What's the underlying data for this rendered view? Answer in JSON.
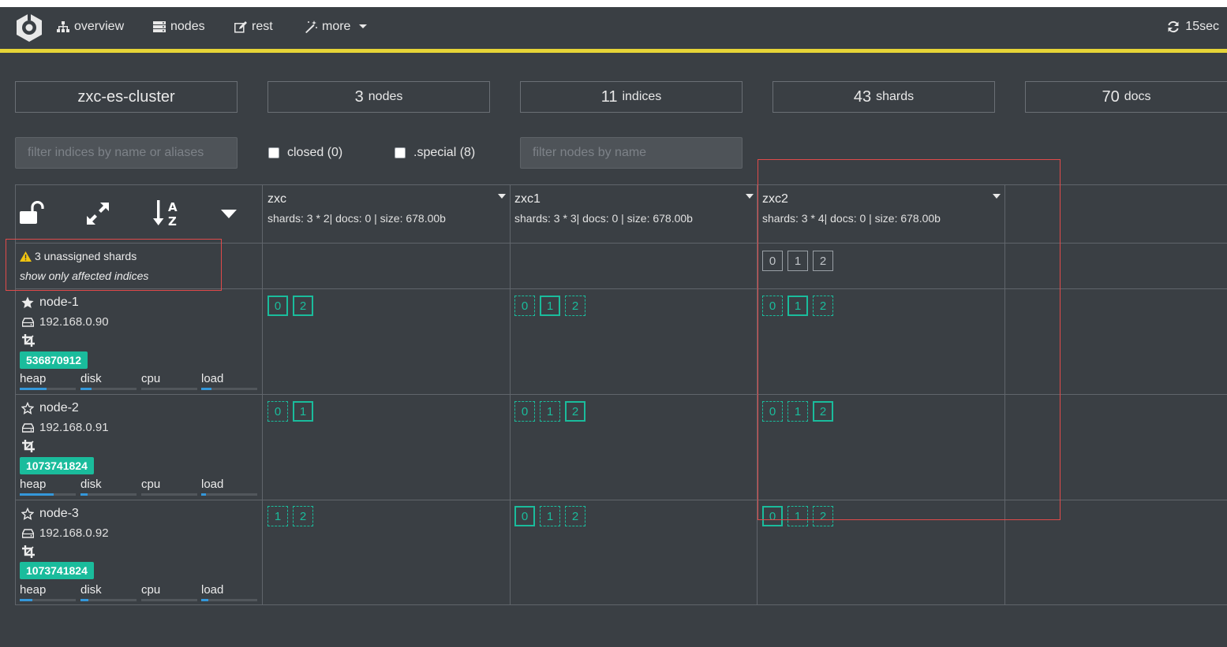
{
  "nav": {
    "overview": "overview",
    "nodes": "nodes",
    "rest": "rest",
    "more": "more",
    "refresh": "15sec"
  },
  "stats": {
    "cluster_name": "zxc-es-cluster",
    "nodes_num": "3",
    "nodes_label": "nodes",
    "indices_num": "11",
    "indices_label": "indices",
    "shards_num": "43",
    "shards_label": "shards",
    "docs_num": "70",
    "docs_label": "docs"
  },
  "filters": {
    "indices_placeholder": "filter indices by name or aliases",
    "closed_label": "closed (0)",
    "special_label": ".special (8)",
    "nodes_placeholder": "filter nodes by name"
  },
  "unassigned": {
    "text": "3 unassigned shards",
    "link": "show only affected indices"
  },
  "indices": [
    {
      "name": "zxc",
      "info": "shards: 3 * 2| docs: 0 | size: 678.00b"
    },
    {
      "name": "zxc1",
      "info": "shards: 3 * 3| docs: 0 | size: 678.00b"
    },
    {
      "name": "zxc2",
      "info": "shards: 3 * 4| docs: 0 | size: 678.00b"
    }
  ],
  "unassigned_shards": {
    "zxc2": [
      "0",
      "1",
      "2"
    ]
  },
  "nodes": [
    {
      "name": "node-1",
      "master": true,
      "ip": "192.168.0.90",
      "heap_badge": "536870912",
      "metrics": {
        "heap": "heap",
        "disk": "disk",
        "cpu": "cpu",
        "load": "load"
      },
      "levels": {
        "heap": 0.48,
        "disk": 0.2,
        "cpu": 0.0,
        "load": 0.18
      },
      "shards": [
        [
          {
            "n": "0",
            "t": "primary"
          },
          {
            "n": "2",
            "t": "primary"
          }
        ],
        [
          {
            "n": "0",
            "t": "replica"
          },
          {
            "n": "1",
            "t": "primary"
          },
          {
            "n": "2",
            "t": "replica"
          }
        ],
        [
          {
            "n": "0",
            "t": "replica"
          },
          {
            "n": "1",
            "t": "primary"
          },
          {
            "n": "2",
            "t": "replica"
          }
        ]
      ]
    },
    {
      "name": "node-2",
      "master": false,
      "ip": "192.168.0.91",
      "heap_badge": "1073741824",
      "metrics": {
        "heap": "heap",
        "disk": "disk",
        "cpu": "cpu",
        "load": "load"
      },
      "levels": {
        "heap": 0.6,
        "disk": 0.12,
        "cpu": 0.0,
        "load": 0.08
      },
      "shards": [
        [
          {
            "n": "0",
            "t": "replica"
          },
          {
            "n": "1",
            "t": "primary"
          }
        ],
        [
          {
            "n": "0",
            "t": "replica"
          },
          {
            "n": "1",
            "t": "replica"
          },
          {
            "n": "2",
            "t": "primary"
          }
        ],
        [
          {
            "n": "0",
            "t": "replica"
          },
          {
            "n": "1",
            "t": "replica"
          },
          {
            "n": "2",
            "t": "primary"
          }
        ]
      ]
    },
    {
      "name": "node-3",
      "master": false,
      "ip": "192.168.0.92",
      "heap_badge": "1073741824",
      "metrics": {
        "heap": "heap",
        "disk": "disk",
        "cpu": "cpu",
        "load": "load"
      },
      "levels": {
        "heap": 0.22,
        "disk": 0.14,
        "cpu": 0.0,
        "load": 0.12
      },
      "shards": [
        [
          {
            "n": "1",
            "t": "replica"
          },
          {
            "n": "2",
            "t": "replica"
          }
        ],
        [
          {
            "n": "0",
            "t": "primary"
          },
          {
            "n": "1",
            "t": "replica"
          },
          {
            "n": "2",
            "t": "replica"
          }
        ],
        [
          {
            "n": "0",
            "t": "primary"
          },
          {
            "n": "1",
            "t": "replica"
          },
          {
            "n": "2",
            "t": "replica"
          }
        ]
      ]
    }
  ],
  "colors": {
    "background": "#3a3f44",
    "accent_bar": "#e6d437",
    "shard": "#1abc9c",
    "metric_fill": "#3498db",
    "annotation": "#e04a4a"
  }
}
